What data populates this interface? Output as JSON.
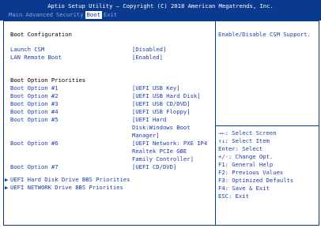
{
  "header": {
    "title": "Aptio Setup Utility – Copyright (C) 2018 American Megatrends, Inc.",
    "tabs": [
      "Main",
      "Advanced",
      "Security",
      "Boot",
      "Exit"
    ],
    "active_tab": "Boot"
  },
  "main": {
    "section_title": "Boot Configuration",
    "launch_csm": {
      "label": "Launch CSM",
      "value": "[Disabled]"
    },
    "lan_remote_boot": {
      "label": "LAN Remote Boot",
      "value": "[Enabled]"
    },
    "priorities_title": "Boot Option Priorities",
    "boot_options": [
      {
        "label": "Boot Option #1",
        "value_lines": [
          "[UEFI USB Key]"
        ]
      },
      {
        "label": "Boot Option #2",
        "value_lines": [
          "[UEFI USB Hard Disk]"
        ]
      },
      {
        "label": "Boot Option #3",
        "value_lines": [
          "[UEFI USB CD/DVD]"
        ]
      },
      {
        "label": "Boot Option #4",
        "value_lines": [
          "[UEFI USB Floppy]"
        ]
      },
      {
        "label": "Boot Option #5",
        "value_lines": [
          "[UEFI Hard",
          "Disk:Windows Boot",
          "Manager]"
        ]
      },
      {
        "label": "Boot Option #6",
        "value_lines": [
          "[UEFI Network: PXE IP4",
          "Realtek PCIe GBE",
          "Family Controller]"
        ]
      },
      {
        "label": "Boot Option #7",
        "value_lines": [
          "[UEFI CD/DVD]"
        ]
      }
    ],
    "submenus": [
      "UEFI Hard Disk Drive BBS Priorities",
      "UEFI NETWORK Drive BBS Priorities"
    ]
  },
  "help": {
    "description": "Enable/Disable CSM Support.",
    "keys": [
      "→←: Select Screen",
      "↑↓: Select Item",
      "Enter: Select",
      "+/-: Change Opt.",
      "F1: General Help",
      "F2: Previous Values",
      "F3: Optimized Defaults",
      "F4: Save & Exit",
      "ESC: Exit"
    ]
  },
  "colors": {
    "header_bg": "#0a3a8f",
    "item_text": "#1a3fa8",
    "static_text": "#000000"
  }
}
